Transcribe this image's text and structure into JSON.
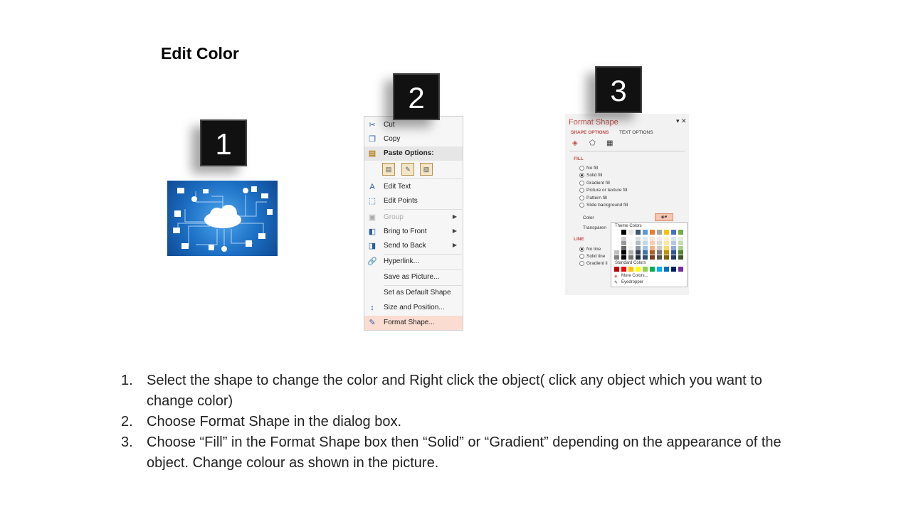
{
  "title": "Edit Color",
  "badges": [
    "1",
    "2",
    "3"
  ],
  "context_menu": {
    "items": [
      {
        "label": "Cut",
        "icon": "scissors-icon"
      },
      {
        "label": "Copy",
        "icon": "copy-icon"
      },
      {
        "label": "Paste Options:",
        "icon": "paste-icon"
      },
      {
        "label": "Edit Text",
        "icon": "edit-text-icon"
      },
      {
        "label": "Edit Points",
        "icon": "edit-points-icon"
      },
      {
        "label": "Group",
        "icon": "group-icon"
      },
      {
        "label": "Bring to Front",
        "icon": "bring-front-icon"
      },
      {
        "label": "Send to Back",
        "icon": "send-back-icon"
      },
      {
        "label": "Hyperlink...",
        "icon": "hyperlink-icon"
      },
      {
        "label": "Save as Picture..."
      },
      {
        "label": "Set as Default Shape"
      },
      {
        "label": "Size and Position...",
        "icon": "size-position-icon"
      },
      {
        "label": "Format Shape...",
        "icon": "format-shape-icon"
      }
    ]
  },
  "format_panel": {
    "title": "Format Shape",
    "tabs": [
      "SHAPE OPTIONS",
      "TEXT OPTIONS"
    ],
    "fill_header": "FILL",
    "fill_options": [
      "No fill",
      "Solid fill",
      "Gradient fill",
      "Picture or texture fill",
      "Pattern fill",
      "Slide background fill"
    ],
    "color_label": "Color",
    "transparency_label": "Transparen",
    "line_header": "LINE",
    "line_options": [
      "No line",
      "Solid line",
      "Gradient li"
    ],
    "popup": {
      "theme_label": "Theme Colors",
      "standard_label": "Standard Colors",
      "more_colors": "More Colors...",
      "eyedropper": "Eyedropper",
      "theme_colors": [
        "#ffffff",
        "#000000",
        "#e7e6e6",
        "#44546a",
        "#5b9bd5",
        "#ed7d31",
        "#a5a5a5",
        "#ffc000",
        "#4472c4",
        "#70ad47"
      ],
      "standard_colors": [
        "#c00000",
        "#ff0000",
        "#ffc000",
        "#ffff00",
        "#92d050",
        "#00b050",
        "#00b0f0",
        "#0070c0",
        "#002060",
        "#7030a0"
      ]
    }
  },
  "steps": [
    {
      "num": "1.",
      "text": "Select the shape to change the color and Right click the object( click any object which you want to change color)"
    },
    {
      "num": "2.",
      "text": "Choose Format Shape in the dialog box."
    },
    {
      "num": "3.",
      "text": "Choose “Fill” in the Format Shape box then “Solid” or “Gradient” depending on the appearance of the object. Change colour as shown in the picture."
    }
  ]
}
